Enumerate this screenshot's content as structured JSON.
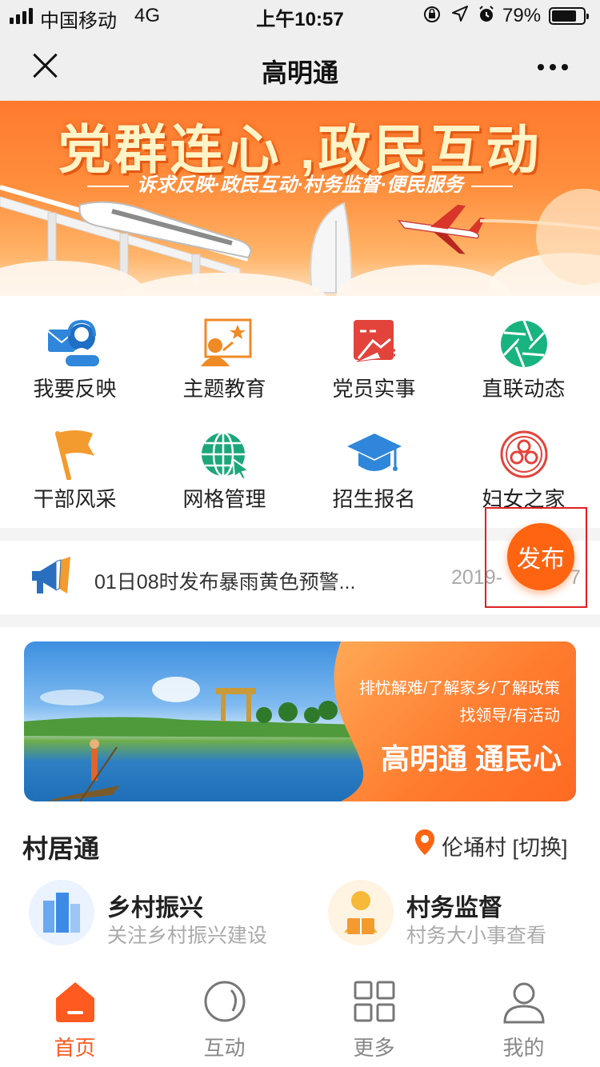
{
  "status_bar": {
    "carrier": "中国移动",
    "network": "4G",
    "time": "上午10:57",
    "battery": "79%",
    "battery_level": 0.79
  },
  "navbar": {
    "title": "高明通",
    "close_icon": "close-icon",
    "more_icon": "more-icon"
  },
  "hero": {
    "headline": "党群连心 ,政民互动",
    "subline": "诉求反映·政民互动·村务监督·便民服务"
  },
  "grid": [
    {
      "label": "我要反映",
      "icon": "feedback-icon"
    },
    {
      "label": "主题教育",
      "icon": "education-icon"
    },
    {
      "label": "党员实事",
      "icon": "party-member-icon"
    },
    {
      "label": "直联动态",
      "icon": "aperture-icon"
    },
    {
      "label": "干部风采",
      "icon": "flag-icon"
    },
    {
      "label": "网格管理",
      "icon": "globe-icon"
    },
    {
      "label": "招生报名",
      "icon": "graduation-cap-icon"
    },
    {
      "label": "妇女之家",
      "icon": "women-emblem-icon"
    }
  ],
  "notice": {
    "text": "01日08时发布暴雨黄色预警...",
    "date": "2019-",
    "date_tail": "7",
    "icon": "megaphone-icon"
  },
  "publish": {
    "label": "发布"
  },
  "promo": {
    "line1": "排忧解难/了解家乡/了解政策",
    "line2": "找领导/有活动",
    "line3": "高明通 通民心"
  },
  "village": {
    "title": "村居通",
    "location": "伦埇村 [切换]",
    "cards": [
      {
        "title": "乡村振兴",
        "subtitle": "关注乡村振兴建设",
        "icon": "buildings-icon"
      },
      {
        "title": "村务监督",
        "subtitle": "村务大小事查看",
        "icon": "reader-icon"
      }
    ]
  },
  "tabbar": [
    {
      "label": "首页",
      "icon": "home-icon",
      "active": true
    },
    {
      "label": "互动",
      "icon": "circle-icon",
      "active": false
    },
    {
      "label": "更多",
      "icon": "grid-icon",
      "active": false
    },
    {
      "label": "我的",
      "icon": "user-icon",
      "active": false
    }
  ],
  "colors": {
    "accent": "#ff5a1f",
    "publish": "#ff6411",
    "highlight_border": "#e02020"
  }
}
